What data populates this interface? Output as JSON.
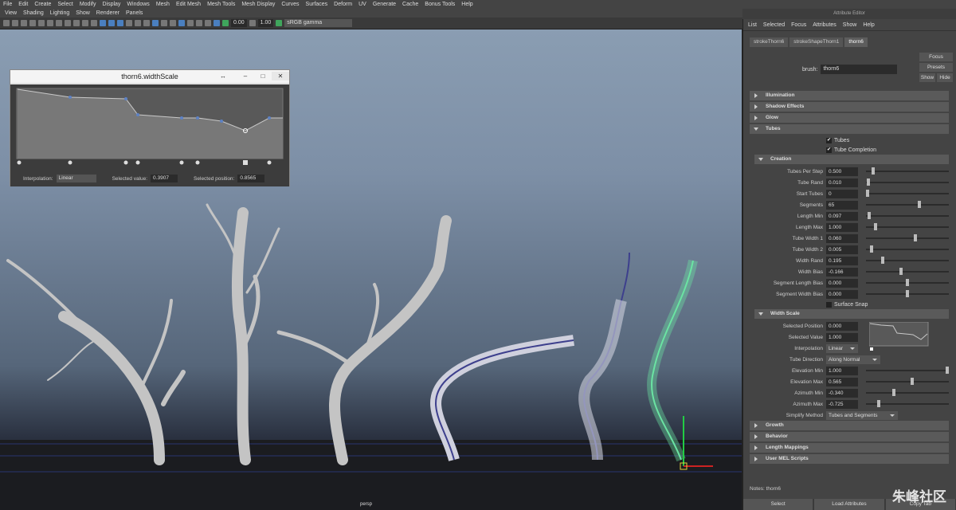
{
  "menubar": [
    "File",
    "Edit",
    "Create",
    "Select",
    "Modify",
    "Display",
    "Windows",
    "Mesh",
    "Edit Mesh",
    "Mesh Tools",
    "Mesh Display",
    "Curves",
    "Surfaces",
    "Deform",
    "UV",
    "Generate",
    "Cache",
    "Bonus Tools",
    "Help"
  ],
  "viewport_menu": [
    "View",
    "Shading",
    "Lighting",
    "Show",
    "Renderer",
    "Panels"
  ],
  "toolbar": {
    "exposure": "0.00",
    "gamma": "1.00",
    "colorspace": "sRGB gamma"
  },
  "viewport_label": "persp",
  "widthscale_window": {
    "title": "thorn6.widthScale",
    "interpolation_label": "Interpolation:",
    "interpolation": "Linear",
    "selected_value_label": "Selected value:",
    "selected_value": "0.3907",
    "selected_position_label": "Selected position:",
    "selected_position": "0.8565"
  },
  "attribute_editor": {
    "title": "Attribute Editor",
    "menu": [
      "List",
      "Selected",
      "Focus",
      "Attributes",
      "Show",
      "Help"
    ],
    "tabs": [
      "strokeThorn6",
      "strokeShapeThorn1",
      "thorn6"
    ],
    "active_tab": "thorn6",
    "brush_label": "brush:",
    "brush_value": "thorn6",
    "buttons": {
      "focus": "Focus",
      "presets": "Presets",
      "show": "Show",
      "hide": "Hide"
    },
    "sections": {
      "illumination": "Illumination",
      "shadow": "Shadow Effects",
      "glow": "Glow",
      "tubes": "Tubes",
      "creation": "Creation",
      "width_scale": "Width Scale",
      "growth": "Growth",
      "behavior": "Behavior",
      "length_mappings": "Length Mappings",
      "user_mel": "User MEL Scripts"
    },
    "checkboxes": {
      "tubes": "Tubes",
      "tube_completion": "Tube Completion",
      "surface_snap": "Surface Snap"
    },
    "creation": [
      {
        "label": "Tubes Per Step",
        "value": "0.500",
        "level": 0.07
      },
      {
        "label": "Tube Rand",
        "value": "0.010",
        "level": 0.01
      },
      {
        "label": "Start Tubes",
        "value": "0",
        "level": 0.0
      },
      {
        "label": "Segments",
        "value": "65",
        "level": 0.65
      },
      {
        "label": "Length Min",
        "value": "0.097",
        "level": 0.02
      },
      {
        "label": "Length Max",
        "value": "1.000",
        "level": 0.1
      },
      {
        "label": "Tube Width 1",
        "value": "0.060",
        "level": 0.6
      },
      {
        "label": "Tube Width 2",
        "value": "0.005",
        "level": 0.05
      },
      {
        "label": "Width Rand",
        "value": "0.195",
        "level": 0.19
      },
      {
        "label": "Width Bias",
        "value": "-0.166",
        "level": 0.42
      },
      {
        "label": "Segment Length Bias",
        "value": "0.000",
        "level": 0.5
      },
      {
        "label": "Segment Width Bias",
        "value": "0.000",
        "level": 0.5
      }
    ],
    "width_scale": {
      "selected_position_label": "Selected Position",
      "selected_position": "0.000",
      "selected_value_label": "Selected Value",
      "selected_value": "1.000",
      "interpolation_label": "Interpolation",
      "interpolation": "Linear"
    },
    "tube_direction_label": "Tube Direction",
    "tube_direction": "Along Normal",
    "angles": [
      {
        "label": "Elevation Min",
        "value": "1.000",
        "level": 1.0
      },
      {
        "label": "Elevation Max",
        "value": "0.565",
        "level": 0.56
      },
      {
        "label": "Azimuth Min",
        "value": "-0.340",
        "level": 0.33
      },
      {
        "label": "Azimuth Max",
        "value": "-0.725",
        "level": 0.14
      }
    ],
    "simplify_label": "Simplify Method",
    "simplify": "Tubes and Segments",
    "notes": "Notes: thorn6",
    "bottom": {
      "select": "Select",
      "load": "Load Attributes",
      "copy": "Copy Tab"
    }
  },
  "watermark": "朱峰社区"
}
